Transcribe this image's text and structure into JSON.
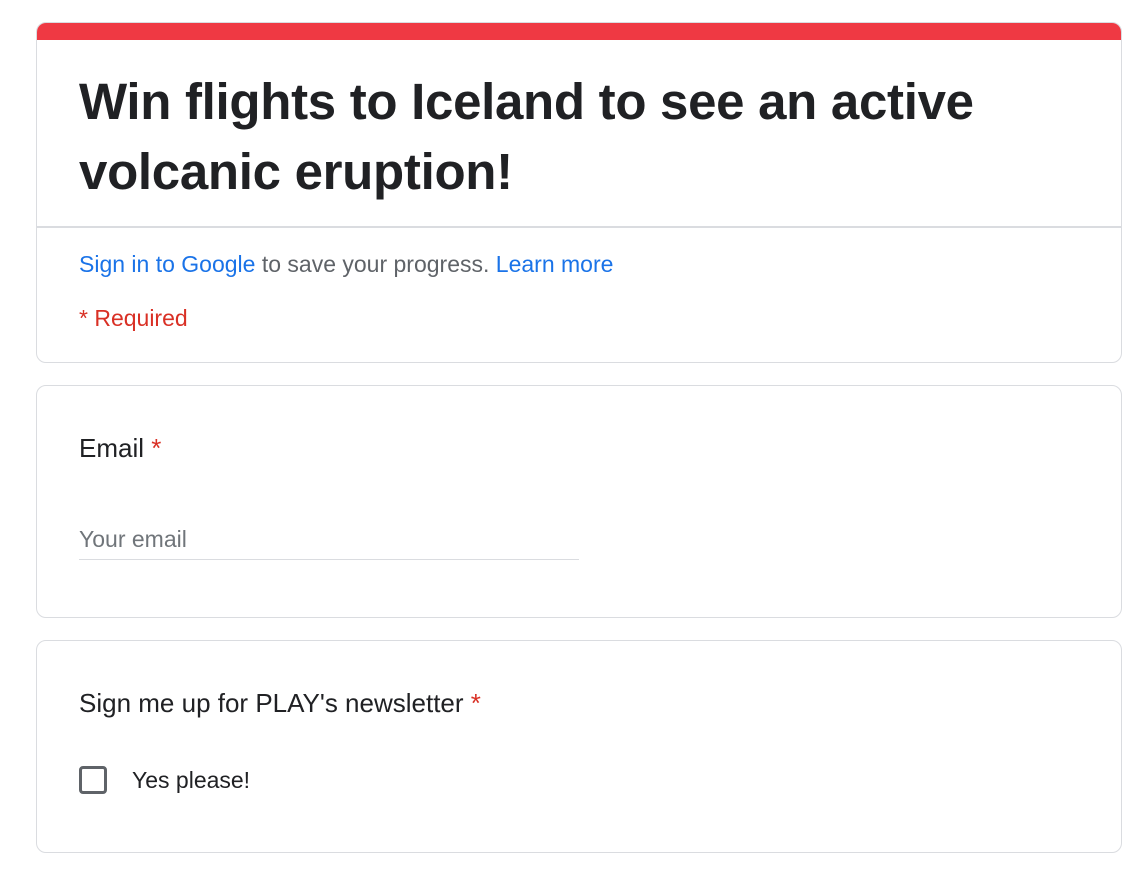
{
  "header": {
    "title": "Win flights to Iceland to see an active volcanic eruption!",
    "signin_link": "Sign in to Google",
    "signin_text": " to save your progress. ",
    "learn_more_link": "Learn more",
    "required_note": "* Required"
  },
  "questions": [
    {
      "label": "Email",
      "required_marker": "*",
      "placeholder": "Your email",
      "value": ""
    },
    {
      "label": "Sign me up for PLAY's newsletter",
      "required_marker": "*",
      "options": [
        {
          "label": "Yes please!",
          "checked": false
        }
      ]
    }
  ],
  "colors": {
    "accent": "#ef3943",
    "link": "#1a73e8",
    "required": "#d93025",
    "border": "#dadce0"
  }
}
